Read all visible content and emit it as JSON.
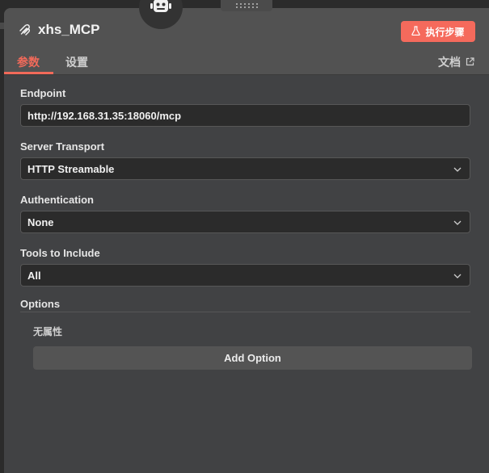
{
  "node": {
    "title": "xhs_MCP",
    "execute_label": "执行步骤",
    "icon": "mcp-icon"
  },
  "tabs": [
    {
      "label": "参数",
      "active": true
    },
    {
      "label": "设置",
      "active": false
    }
  ],
  "docs_label": "文档",
  "fields": {
    "endpoint": {
      "label": "Endpoint",
      "value": "http://192.168.31.35:18060/mcp"
    },
    "server_transport": {
      "label": "Server Transport",
      "value": "HTTP Streamable"
    },
    "authentication": {
      "label": "Authentication",
      "value": "None"
    },
    "tools_to_include": {
      "label": "Tools to Include",
      "value": "All"
    }
  },
  "options": {
    "label": "Options",
    "empty_text": "无属性",
    "add_label": "Add Option"
  },
  "colors": {
    "accent": "#f56a5c",
    "panel": "#414244",
    "header": "#525252",
    "field_bg": "#2b2b2b"
  }
}
